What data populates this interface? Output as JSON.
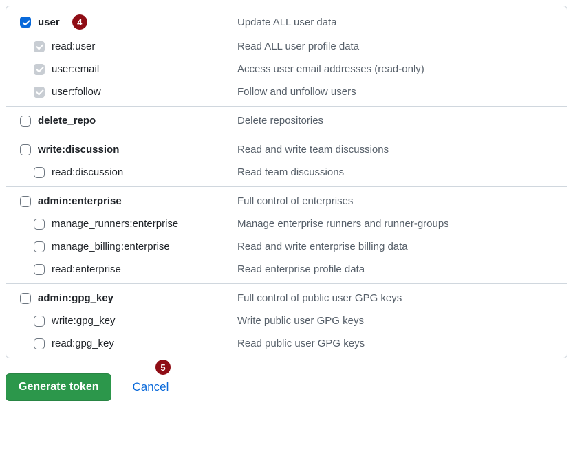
{
  "badges": {
    "b4": "4",
    "b5": "5"
  },
  "scopes": {
    "user": {
      "name": "user",
      "desc": "Update ALL user data",
      "children": {
        "read_user": {
          "name": "read:user",
          "desc": "Read ALL user profile data"
        },
        "user_email": {
          "name": "user:email",
          "desc": "Access user email addresses (read-only)"
        },
        "user_follow": {
          "name": "user:follow",
          "desc": "Follow and unfollow users"
        }
      }
    },
    "delete_repo": {
      "name": "delete_repo",
      "desc": "Delete repositories"
    },
    "write_discussion": {
      "name": "write:discussion",
      "desc": "Read and write team discussions",
      "children": {
        "read_discussion": {
          "name": "read:discussion",
          "desc": "Read team discussions"
        }
      }
    },
    "admin_enterprise": {
      "name": "admin:enterprise",
      "desc": "Full control of enterprises",
      "children": {
        "manage_runners": {
          "name": "manage_runners:enterprise",
          "desc": "Manage enterprise runners and runner-groups"
        },
        "manage_billing": {
          "name": "manage_billing:enterprise",
          "desc": "Read and write enterprise billing data"
        },
        "read_enterprise": {
          "name": "read:enterprise",
          "desc": "Read enterprise profile data"
        }
      }
    },
    "admin_gpg": {
      "name": "admin:gpg_key",
      "desc": "Full control of public user GPG keys",
      "children": {
        "write_gpg": {
          "name": "write:gpg_key",
          "desc": "Write public user GPG keys"
        },
        "read_gpg": {
          "name": "read:gpg_key",
          "desc": "Read public user GPG keys"
        }
      }
    }
  },
  "footer": {
    "generate": "Generate token",
    "cancel": "Cancel"
  }
}
